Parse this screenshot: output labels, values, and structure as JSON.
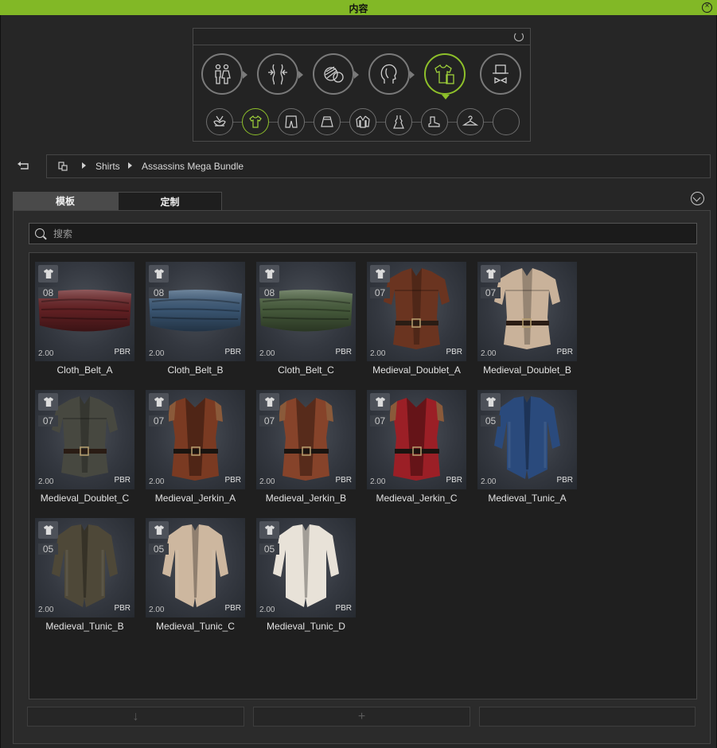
{
  "window": {
    "title": "内容"
  },
  "breadcrumb": {
    "items": [
      "Shirts",
      "Assassins Mega Bundle"
    ]
  },
  "tabs": [
    {
      "label": "模板"
    },
    {
      "label": "定制"
    }
  ],
  "search": {
    "placeholder": "搜索"
  },
  "categories": {
    "main": [
      "body-icon",
      "morph-icon",
      "material-icon",
      "head-icon",
      "cloth-icon",
      "accessory-icon"
    ],
    "main_active": "cloth-icon",
    "sub": [
      "underwear-icon",
      "shirt-icon",
      "pants-icon",
      "skirt-icon",
      "jacket-icon",
      "dress-icon",
      "shoe-icon",
      "hanger-icon",
      "empty-icon"
    ],
    "sub_active": "shirt-icon"
  },
  "items": [
    {
      "name": "Cloth_Belt_A",
      "count": "08",
      "version": "2.00",
      "tag": "PBR",
      "kind": "belt",
      "color": "#6b2326"
    },
    {
      "name": "Cloth_Belt_B",
      "count": "08",
      "version": "2.00",
      "tag": "PBR",
      "kind": "belt",
      "color": "#3f5d7c"
    },
    {
      "name": "Cloth_Belt_C",
      "count": "08",
      "version": "2.00",
      "tag": "PBR",
      "kind": "belt",
      "color": "#4c6240"
    },
    {
      "name": "Medieval_Doublet_A",
      "count": "07",
      "version": "2.00",
      "tag": "PBR",
      "kind": "doublet",
      "color": "#6a3420"
    },
    {
      "name": "Medieval_Doublet_B",
      "count": "07",
      "version": "2.00",
      "tag": "PBR",
      "kind": "doublet",
      "color": "#c9b29a"
    },
    {
      "name": "Medieval_Doublet_C",
      "count": "07",
      "version": "2.00",
      "tag": "PBR",
      "kind": "doublet",
      "color": "#474840"
    },
    {
      "name": "Medieval_Jerkin_A",
      "count": "07",
      "version": "2.00",
      "tag": "PBR",
      "kind": "jerkin",
      "color": "#7a3a22"
    },
    {
      "name": "Medieval_Jerkin_B",
      "count": "07",
      "version": "2.00",
      "tag": "PBR",
      "kind": "jerkin",
      "color": "#86432a"
    },
    {
      "name": "Medieval_Jerkin_C",
      "count": "07",
      "version": "2.00",
      "tag": "PBR",
      "kind": "jerkin",
      "color": "#9b1f26"
    },
    {
      "name": "Medieval_Tunic_A",
      "count": "05",
      "version": "2.00",
      "tag": "PBR",
      "kind": "tunic",
      "color": "#2a4a7c"
    },
    {
      "name": "Medieval_Tunic_B",
      "count": "05",
      "version": "2.00",
      "tag": "PBR",
      "kind": "tunic",
      "color": "#4e4838"
    },
    {
      "name": "Medieval_Tunic_C",
      "count": "05",
      "version": "2.00",
      "tag": "PBR",
      "kind": "tunic",
      "color": "#cdb79f"
    },
    {
      "name": "Medieval_Tunic_D",
      "count": "05",
      "version": "2.00",
      "tag": "PBR",
      "kind": "tunic",
      "color": "#e8e2d8"
    }
  ],
  "footer": {
    "buttons": [
      "download-icon",
      "add-icon",
      "delete-icon"
    ]
  },
  "colors": {
    "accent": "#82b826",
    "active_ring": "#8ec02a"
  }
}
